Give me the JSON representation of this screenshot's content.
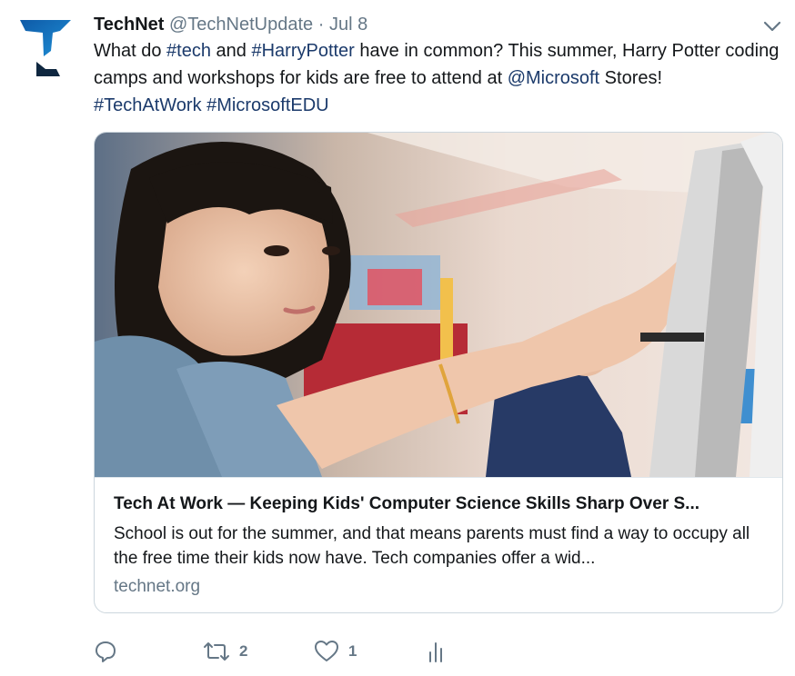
{
  "tweet": {
    "display_name": "TechNet",
    "handle": "@TechNetUpdate",
    "separator": "·",
    "date": "Jul 8",
    "text": {
      "p1": "What do ",
      "tag_tech": "#tech",
      "p2": " and ",
      "tag_hp": "#HarryPotter",
      "p3": " have in common? This summer, Harry Potter coding camps and workshops for kids are free to attend at ",
      "mention": "@Microsoft",
      "p4": " Stores! ",
      "tag_taw": "#TechAtWork",
      "p5": " ",
      "tag_edu": "#MicrosoftEDU"
    }
  },
  "card": {
    "title": "Tech At Work — Keeping Kids' Computer Science Skills Sharp Over S...",
    "description": "School is out for the summer, and that means parents must find a way to occupy all the free time their kids now have. Tech companies offer a wid...",
    "domain": "technet.org"
  },
  "actions": {
    "reply_icon": "reply-icon",
    "retweet_icon": "retweet-icon",
    "retweet_count": "2",
    "like_icon": "heart-icon",
    "like_count": "1",
    "analytics_icon": "analytics-icon"
  },
  "colors": {
    "link": "#1b3a6b",
    "secondary_text": "#657786",
    "border": "#ccd6dd",
    "logo_blue": "#1f6fb2",
    "logo_navy": "#0f2740"
  }
}
